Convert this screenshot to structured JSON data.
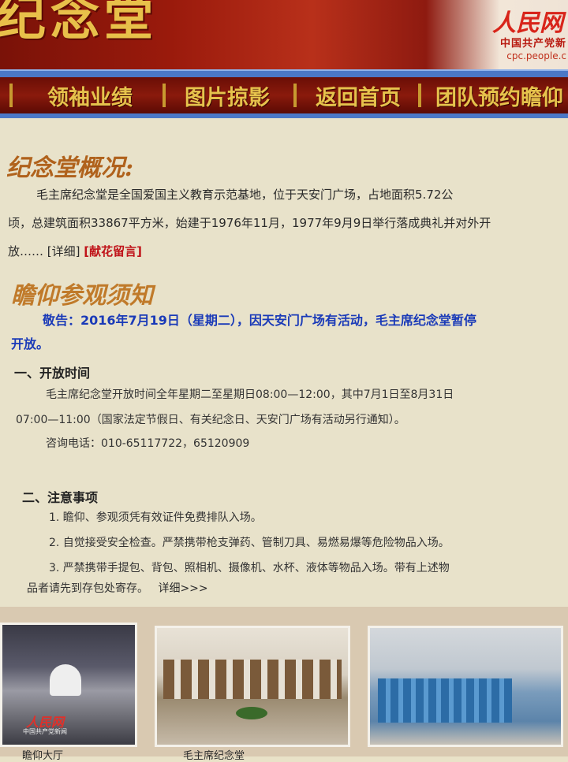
{
  "banner": {
    "title": "纪念堂",
    "logo": "人民网",
    "org": "中国共产党新",
    "url": "cpc.people.c"
  },
  "nav": {
    "items": [
      {
        "label": "领袖业绩"
      },
      {
        "label": "图片掠影"
      },
      {
        "label": "返回首页"
      },
      {
        "label": "团队预约瞻仰"
      }
    ]
  },
  "overview": {
    "heading": "纪念堂概况:",
    "line1": "毛主席纪念堂是全国爱国主义教育示范基地，位于天安门广场，占地面积5.72公",
    "line2": "顷，总建筑面积33867平方米，始建于1976年11月，1977年9月9日举行落成典礼并对外开",
    "line3_prefix": "放……",
    "detail_link": "[详细]",
    "flower_link": "[献花留言]"
  },
  "visit": {
    "heading": "瞻仰参观须知",
    "notice_line1": "敬告：2016年7月19日（星期二），因天安门广场有活动，毛主席纪念堂暂停",
    "notice_line2": "开放。",
    "section1_title": "一、开放时间",
    "hours_line1": "毛主席纪念堂开放时间全年星期二至星期日08:00—12:00，其中7月1日至8月31日",
    "hours_line2": "07:00—11:00（国家法定节假日、有关纪念日、天安门广场有活动另行通知）。",
    "phone": "咨询电话：010-65117722，65120909",
    "section2_title": "二、注意事项",
    "rule1": "1. 瞻仰、参观须凭有效证件免费排队入场。",
    "rule2": "2. 自觉接受安全检查。严禁携带枪支弹药、管制刀具、易燃易爆等危险物品入场。",
    "rule3_line1": "3. 严禁携带手提包、背包、照相机、摄像机、水杯、液体等物品入场。带有上述物",
    "rule3_line2": "品者请先到存包处寄存。",
    "rule_detail_link": "详细>>>"
  },
  "photos": {
    "watermark": "人民网",
    "watermark_sub": "中国共产党新闻",
    "caption1": "瞻仰大厅",
    "caption2": "毛主席纪念堂"
  }
}
